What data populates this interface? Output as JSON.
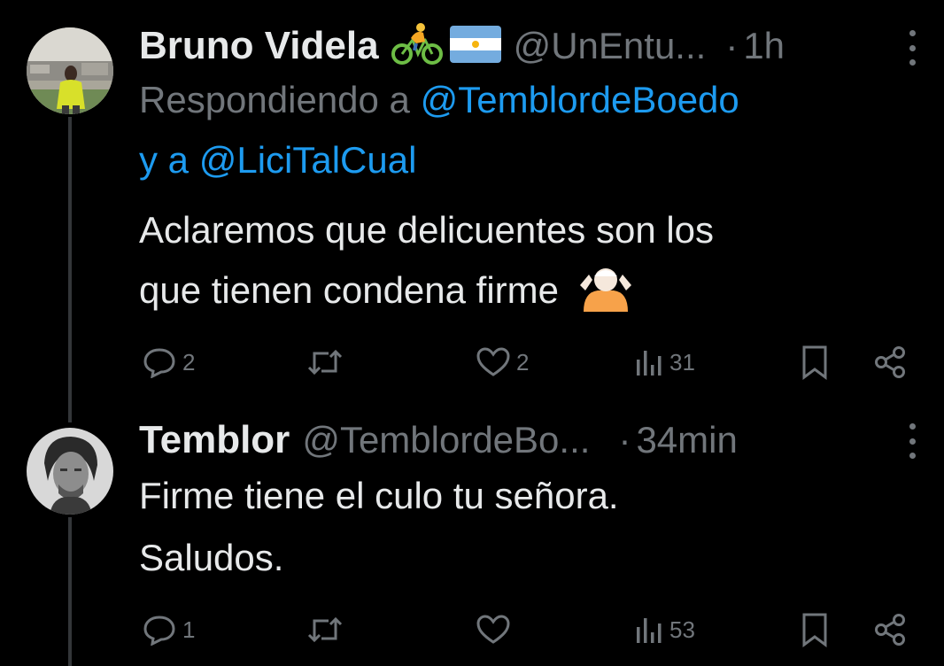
{
  "tweets": [
    {
      "name": "Bruno Videla",
      "badges": [
        "cyclist-emoji",
        "argentina-flag-emoji"
      ],
      "handle": "@UnEntu...",
      "dot": "·",
      "time": "1h",
      "reply_prefix": "Respondiendo a",
      "reply_mention_1": "@TemblordeBoedo",
      "reply_connector": "y a",
      "reply_mention_2": "@LiciTalCual",
      "text_line_1": "Aclaremos que delicuentes son los",
      "text_line_2": "que tienen condena firme",
      "text_emoji": "shrug-emoji",
      "replies": "2",
      "retweets": "",
      "likes": "2",
      "views": "31"
    },
    {
      "name": "Temblor",
      "handle": "@TemblordeBo...",
      "dot": "·",
      "time": "34min",
      "text_line_1": "Firme tiene el culo tu señora.",
      "text_line_2": "Saludos.",
      "replies": "1",
      "retweets": "",
      "likes": "",
      "views": "53"
    }
  ],
  "colors": {
    "background": "#000000",
    "text": "#e7e9ea",
    "muted": "#71767b",
    "link": "#1d9bf0",
    "thread_line": "#333639"
  }
}
